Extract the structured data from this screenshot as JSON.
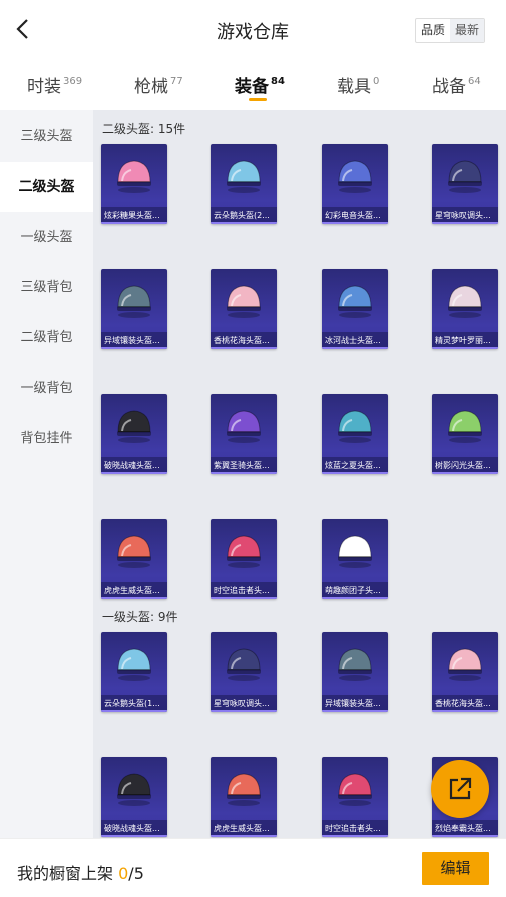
{
  "header": {
    "title": "游戏仓库",
    "sort_quality": "品质",
    "sort_newest": "最新"
  },
  "tabs": [
    {
      "label": "时装",
      "count": "369"
    },
    {
      "label": "枪械",
      "count": "77"
    },
    {
      "label": "装备",
      "count": "84"
    },
    {
      "label": "载具",
      "count": "0"
    },
    {
      "label": "战备",
      "count": "64"
    }
  ],
  "sidebar": [
    "三级头盔",
    "二级头盔",
    "一级头盔",
    "三级背包",
    "二级背包",
    "一级背包",
    "背包挂件"
  ],
  "sections": [
    {
      "title": "二级头盔: 15件",
      "items": [
        "炫彩糖果头盔...",
        "云朵鹅头盔(2...",
        "幻彩电音头盔...",
        "星穹咏叹调头...",
        "异域镶装头盔...",
        "香桃花海头盔...",
        "冰河战士头盔...",
        "精灵梦叶罗丽...",
        "破晓战魂头盔...",
        "紫翼圣骑头盔...",
        "炫蓝之夏头盔...",
        "树影闪光头盔...",
        "虎虎生威头盔...",
        "时空追击者头...",
        "萌趣颜团子头..."
      ]
    },
    {
      "title": "一级头盔: 9件",
      "items": [
        "云朵鹅头盔(1...",
        "星穹咏叹调头...",
        "异域镶装头盔...",
        "香桃花海头盔...",
        "破晓战魂头盔...",
        "虎虎生威头盔...",
        "时空追击者头...",
        "烈焰奉霸头盔..."
      ]
    }
  ],
  "helmet_colors": [
    "#f08ab5",
    "#7fc6e6",
    "#5a6fd6",
    "#3b3f7a",
    "#5f7a8a",
    "#f2b6c4",
    "#5a8fd8",
    "#e9d6e0",
    "#2a2a30",
    "#7c4fd0",
    "#4fb0c8",
    "#8ccf6a",
    "#e86a5a",
    "#e04a72",
    "#ffffff",
    "#7fc6e6",
    "#3b3f7a",
    "#5f7a8a",
    "#f2b6c4",
    "#2a2a30",
    "#e86a5a",
    "#e04a72",
    "#6a5acd"
  ],
  "bottom": {
    "shelf_label": "我的橱窗上架",
    "shelf_count": "0",
    "shelf_total": "/5",
    "edit_label": "编辑"
  },
  "colors": {
    "accent": "#f5a300",
    "card_bg": "#3a35a0"
  }
}
